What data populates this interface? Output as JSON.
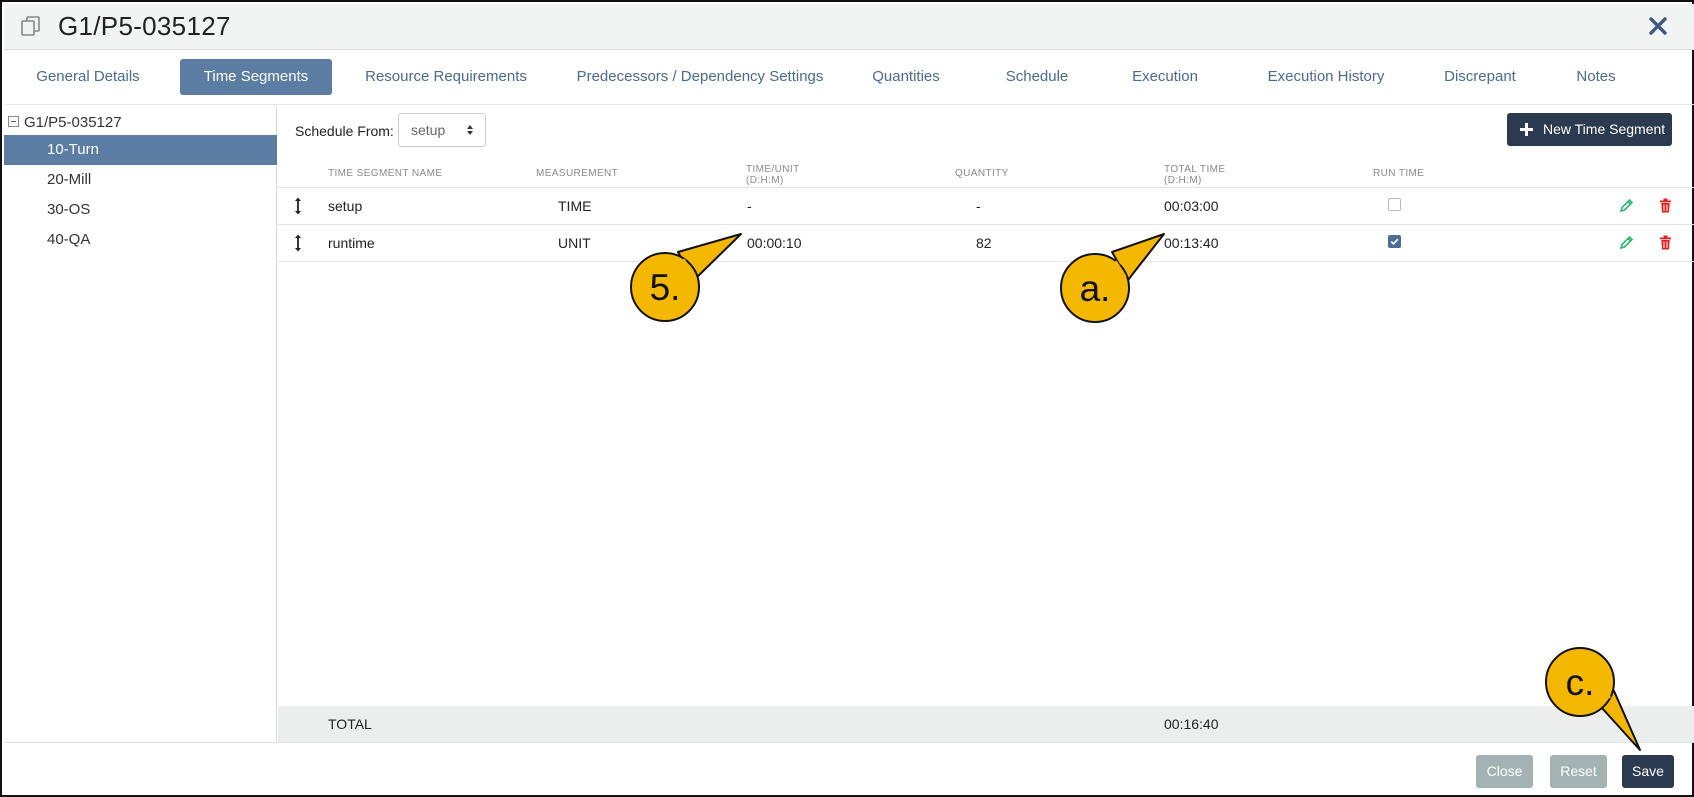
{
  "window": {
    "title": "G1/P5-035127"
  },
  "tabs": [
    {
      "label": "General Details"
    },
    {
      "label": "Time Segments",
      "active": true
    },
    {
      "label": "Resource Requirements"
    },
    {
      "label": "Predecessors / Dependency Settings"
    },
    {
      "label": "Quantities"
    },
    {
      "label": "Schedule"
    },
    {
      "label": "Execution"
    },
    {
      "label": "Execution History"
    },
    {
      "label": "Discrepant"
    },
    {
      "label": "Notes"
    }
  ],
  "tree": {
    "root": "G1/P5-035127",
    "items": [
      {
        "label": "10-Turn",
        "active": true
      },
      {
        "label": "20-Mill"
      },
      {
        "label": "30-OS"
      },
      {
        "label": "40-QA"
      }
    ]
  },
  "toolbar": {
    "schedule_from_label": "Schedule From:",
    "schedule_from_value": "setup",
    "new_segment_label": "New Time Segment"
  },
  "table": {
    "headers": {
      "name": "TIME SEGMENT NAME",
      "measurement": "MEASUREMENT",
      "time_unit": "TIME/UNIT",
      "time_unit_sub": "(D:H:M)",
      "quantity": "QUANTITY",
      "total_time": "TOTAL TIME",
      "total_time_sub": "(D:H:M)",
      "run_time": "RUN TIME"
    },
    "rows": [
      {
        "name": "setup",
        "measurement": "TIME",
        "time_unit": "-",
        "quantity": "-",
        "total_time": "00:03:00",
        "run_time": false
      },
      {
        "name": "runtime",
        "measurement": "UNIT",
        "time_unit": "00:00:10",
        "quantity": "82",
        "total_time": "00:13:40",
        "run_time": true
      }
    ],
    "total": {
      "label": "TOTAL",
      "total_time": "00:16:40"
    }
  },
  "footer": {
    "close_label": "Close",
    "reset_label": "Reset",
    "save_label": "Save"
  },
  "callouts": {
    "five": "5.",
    "a": "a.",
    "c": "c."
  },
  "colors": {
    "accent": "#5b7ca3",
    "dark_button": "#2b3a4e",
    "callout_fill": "#f5b800",
    "edit": "#2bb673",
    "delete": "#e02020"
  }
}
